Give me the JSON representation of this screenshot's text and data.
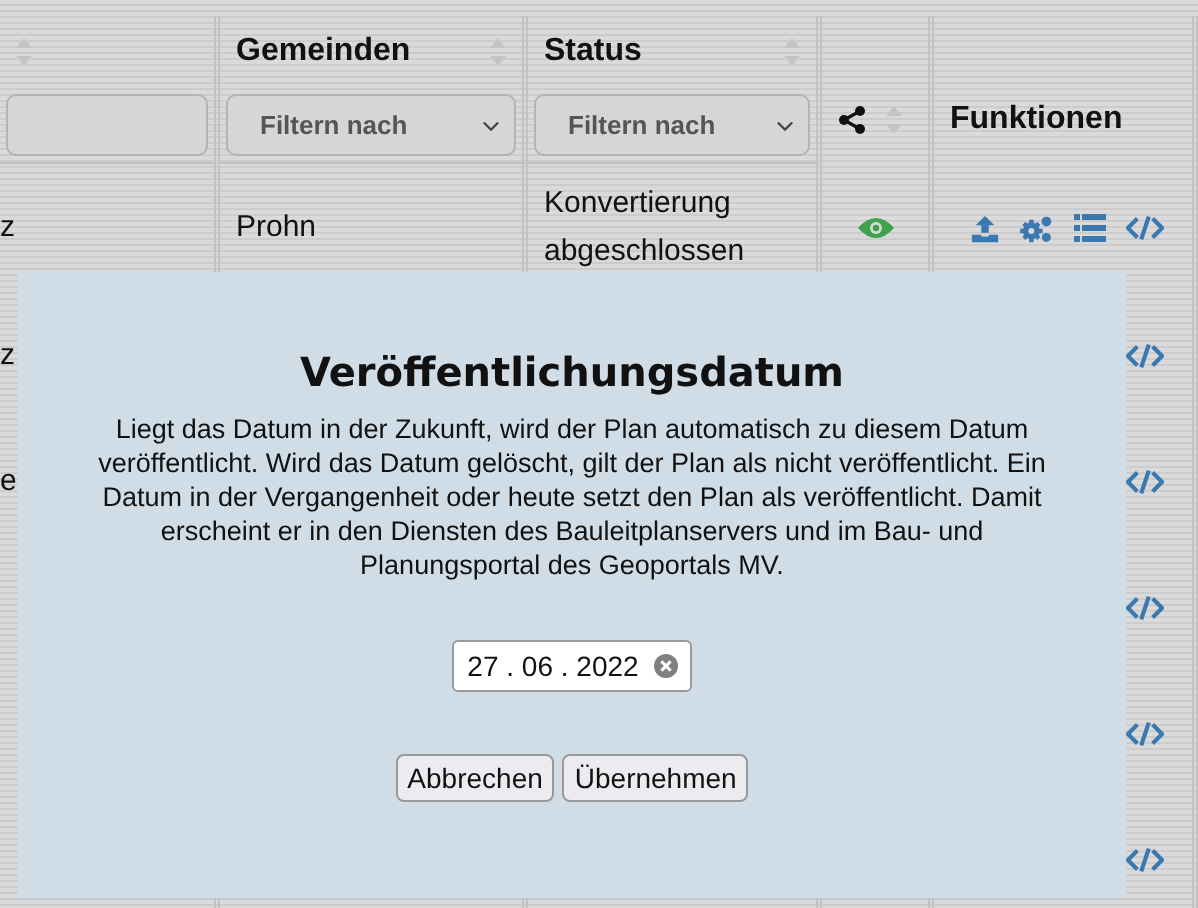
{
  "table": {
    "columns": [
      {
        "kind": "filter-input",
        "sortable": true
      },
      {
        "kind": "filter-select",
        "label": "Gemeinden",
        "filter": "Filtern nach",
        "sortable": true
      },
      {
        "kind": "filter-select",
        "label": "Status",
        "filter": "Filtern nach",
        "sortable": true
      },
      {
        "kind": "share",
        "sortable": true
      },
      {
        "kind": "functions",
        "label": "Funktionen",
        "sortable": false
      }
    ],
    "rows": [
      {
        "column_1": "z",
        "gemeinde": "Prohn",
        "status": "Konvertierung abgeschlossen",
        "published": true,
        "functions": [
          {
            "kind": "upload"
          },
          {
            "kind": "settings"
          },
          {
            "kind": "list"
          },
          {
            "kind": "code"
          }
        ]
      },
      {
        "column_1": "z",
        "functions": [
          {
            "kind": "code"
          }
        ]
      },
      {
        "column_1": "e",
        "functions": [
          {
            "kind": "code"
          }
        ]
      },
      {
        "functions": [
          {
            "kind": "code"
          }
        ]
      },
      {
        "functions": [
          {
            "kind": "code"
          }
        ]
      },
      {
        "functions": [
          {
            "kind": "code"
          }
        ]
      }
    ]
  },
  "dialog": {
    "title": "Veröffentlichungsdatum",
    "text": "Liegt das Datum in der Zukunft, wird der Plan automatisch zu diesem Datum veröffentlicht. Wird das Datum gelöscht, gilt der Plan als nicht veröffentlicht. Ein Datum in der Vergangenheit oder heute setzt den Plan als veröffentlicht. Damit erscheint er in den Diensten des Bauleitplanservers und im Bau- und Planungsportal des Geoportals MV.",
    "date": "27 . 06 . 2022",
    "buttons": [
      "Abbrechen",
      "Übernehmen"
    ]
  }
}
